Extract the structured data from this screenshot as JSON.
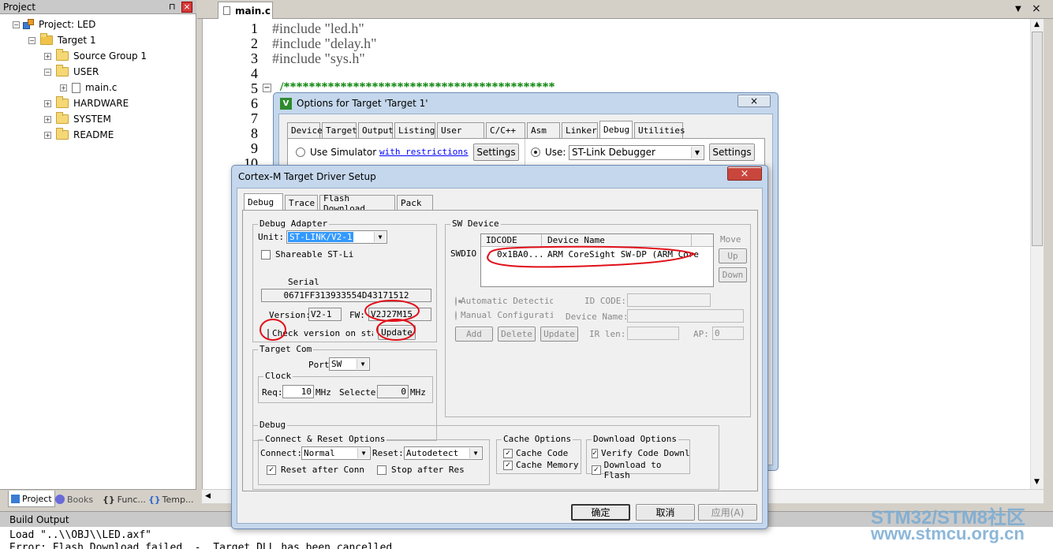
{
  "project_panel": {
    "title": "Project",
    "pin": "⊓",
    "close": "×",
    "tree": [
      {
        "label": "Project: LED"
      },
      {
        "label": "Target 1"
      },
      {
        "label": "Source Group 1"
      },
      {
        "label": "USER"
      },
      {
        "label": "main.c"
      },
      {
        "label": "HARDWARE"
      },
      {
        "label": "SYSTEM"
      },
      {
        "label": "README"
      }
    ],
    "bottom_tabs": [
      "Project",
      "Books",
      "Func...",
      "Temp..."
    ],
    "bottom_tab_icons": [
      "{}",
      "{}"
    ]
  },
  "editor": {
    "tab": "main.c",
    "line_numbers": [
      "1",
      "2",
      "3",
      "4",
      "5",
      "6",
      "7",
      "8",
      "9",
      "10"
    ],
    "lines": [
      "#include \"led.h\"",
      "#include \"delay.h\"",
      "#include \"sys.h\"",
      "",
      "/*******************************************"
    ],
    "collapse": "−"
  },
  "build_output": {
    "title": "Build Output",
    "lines": [
      "Load \"..\\\\OBJ\\\\LED.axf\"",
      "Error: Flash Download failed  -  Target DLL has been cancelled"
    ]
  },
  "options_dialog": {
    "title": "Options for Target 'Target 1'",
    "close": "×",
    "tabs": [
      "Device",
      "Target",
      "Output",
      "Listing",
      "User",
      "C/C++",
      "Asm",
      "Linker",
      "Debug",
      "Utilities"
    ],
    "use_simulator": "Use Simulator",
    "with_restrictions": "with restrictions",
    "settings_left": "Settings",
    "use": "Use:",
    "debugger": "ST-Link Debugger",
    "settings_right": "Settings"
  },
  "driver_dialog": {
    "title": "Cortex-M Target Driver Setup",
    "close": "×",
    "tabs": [
      "Debug",
      "Trace",
      "Flash Download",
      "Pack"
    ],
    "debug_adapter": {
      "legend": "Debug Adapter",
      "unit_label": "Unit:",
      "unit_value": "ST-LINK/V2-1",
      "shareable": "Shareable ST-Li",
      "serial_label": "Serial",
      "serial_value": "0671FF313933554D43171512",
      "version_label": "Version:",
      "version_value": "V2-1",
      "fw_label": "FW:",
      "fw_value": "V2J27M15",
      "check_version": "Check version on sta",
      "update": "Update"
    },
    "target_com": {
      "legend": "Target Com",
      "port_label": "Port",
      "port_value": "SW",
      "clock_legend": "Clock",
      "req_label": "Req:",
      "req_value": "10",
      "req_unit": "MHz",
      "selected_label": "Selected",
      "selected_value": "0",
      "selected_unit": "MHz"
    },
    "sw_device": {
      "legend": "SW Device",
      "swdio": "SWDIO",
      "col_idcode": "IDCODE",
      "col_name": "Device Name",
      "row_idcode": "0x1BA0...",
      "row_name": "ARM CoreSight SW-DP (ARM Core",
      "move": "Move",
      "up": "Up",
      "down": "Down",
      "auto_detect": "Automatic Detectio",
      "manual_config": "Manual Configurati",
      "id_code": "ID CODE:",
      "device_name": "Device Name:",
      "add": "Add",
      "delete": "Delete",
      "update": "Update",
      "ir_len": "IR len:",
      "ap": "AP:",
      "ap_value": "0"
    },
    "debug_group": {
      "legend": "Debug",
      "connect_reset_legend": "Connect & Reset Options",
      "connect_label": "Connect:",
      "connect_value": "Normal",
      "reset_label": "Reset:",
      "reset_value": "Autodetect",
      "reset_after_conn": "Reset after Conn",
      "stop_after_reset": "Stop after Res",
      "cache_legend": "Cache Options",
      "cache_code": "Cache Code",
      "cache_memory": "Cache Memory",
      "download_legend": "Download Options",
      "verify_code": "Verify Code Downlo",
      "download_to_flash": "Download to Flash"
    },
    "ok": "确定",
    "cancel": "取消",
    "apply": "应用(A)"
  },
  "watermark": {
    "line1": "STM32/STM8社区",
    "line2": "www.stmcu.org.cn"
  },
  "colors": {
    "annotation": "#e0101a",
    "selection": "#3399ff",
    "code_keyword": "#1a1aa6",
    "code_string": "#b5008f",
    "comment": "#008000"
  }
}
